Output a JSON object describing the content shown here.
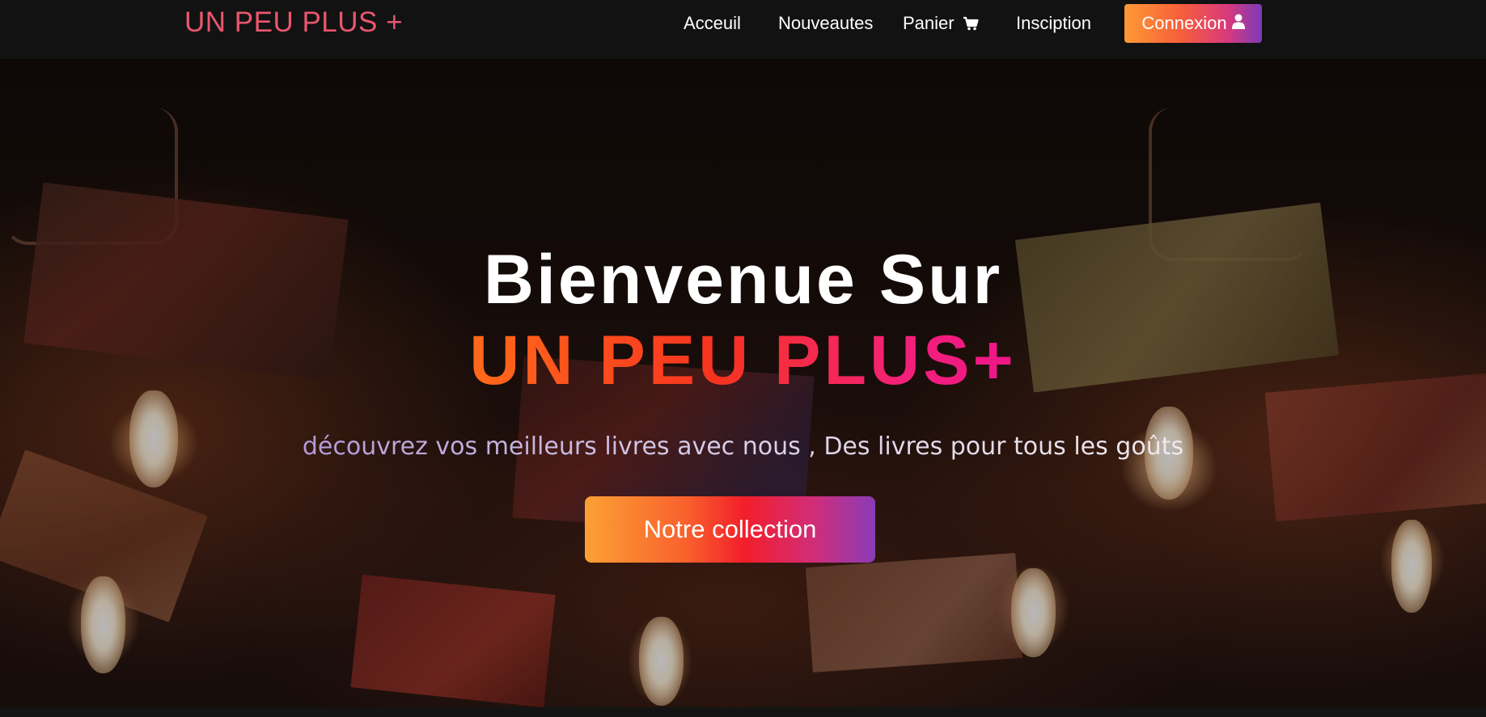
{
  "navbar": {
    "brand": "UN PEU PLUS +",
    "links": {
      "accueil": "Acceuil",
      "nouveautes": "Nouveautes",
      "panier": "Panier",
      "inscription": "Insciption"
    },
    "panier_icon": "shopping-cart-icon",
    "connexion_label": "Connexion",
    "connexion_icon": "user-icon"
  },
  "hero": {
    "title": "Bienvenue Sur",
    "brand": "UN PEU PLUS+",
    "tagline": "découvrez vos meilleurs livres avec nous , Des livres pour tous les goûts",
    "cta_label": "Notre collection"
  },
  "colors": {
    "brand": "#e8576e",
    "nav_background": "#121212",
    "gradient_orange": "#fd9a35",
    "gradient_red": "#f31e2a",
    "gradient_purple": "#8a3bb8"
  }
}
